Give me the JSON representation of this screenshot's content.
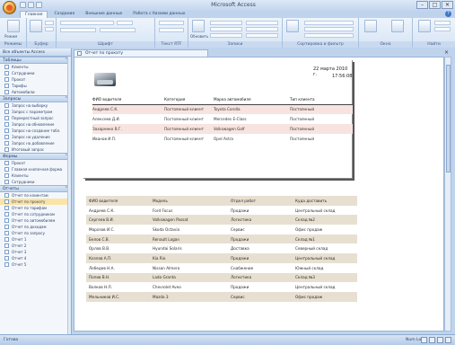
{
  "window": {
    "title": "Microsoft Access",
    "controls": [
      "–",
      "□",
      "✕"
    ]
  },
  "ribbon": {
    "tabs": [
      "Главная",
      "Создание",
      "Внешние данные",
      "Работа с базами данных"
    ],
    "active_tab": 0,
    "groups": [
      "Режимы",
      "Буфер обмена",
      "Шрифт",
      "Текст RTF",
      "Записи",
      "Сортировка и фильтр",
      "Окно",
      "Найти"
    ],
    "big_buttons": [
      "Режим",
      "Вставить",
      "Обновить все",
      "Размер по форме",
      "Перейти",
      "Найти"
    ]
  },
  "nav": {
    "header": "Все объекты Access",
    "sections": [
      {
        "title": "Таблицы",
        "items": [
          "Клиенты",
          "Сотрудники",
          "Прокат",
          "Тарифы",
          "Автомобили"
        ]
      },
      {
        "title": "Запросы",
        "items": [
          "Запрос на выборку",
          "Запрос с параметром",
          "Перекрестный запрос",
          "Запрос на обновление",
          "Запрос на создание табл.",
          "Запрос на удаление",
          "Запрос на добавление",
          "Итоговый запрос"
        ]
      },
      {
        "title": "Формы",
        "items": [
          "Прокат",
          "Главная кнопочная форма",
          "Клиенты",
          "Сотрудники"
        ]
      },
      {
        "title": "Отчеты",
        "items": [
          "Отчет по клиентам",
          "Отчет по прокату",
          "Отчет по тарифам",
          "Отчет по сотрудникам",
          "Отчет по автомобилям",
          "Отчет по доходам",
          "Отчет по запросу",
          "Отчет 1",
          "Отчет 2",
          "Отчет 3",
          "Отчет 4",
          "Отчет 5"
        ]
      }
    ],
    "selected": "Отчет по прокату"
  },
  "document": {
    "tab_title": "Отчет по прокату",
    "page": {
      "date": "22 марта 2010 г.",
      "time": "17:56:08",
      "headers": [
        "ФИО водителя",
        "Категория",
        "Марка автомобиля",
        "Тип клиента"
      ],
      "rows": [
        [
          "Андреев С.К.",
          "Постоянный клиент",
          "Toyota Corolla",
          "Постоянный"
        ],
        [
          "Алексеев Д.И.",
          "Постоянный клиент",
          "Mercedes E-Class",
          "Постоянный"
        ],
        [
          "Захаренко В.Г.",
          "Постоянный клиент",
          "Volkswagen Golf",
          "Постоянный"
        ],
        [
          "Иванов И.П.",
          "Постоянный клиент",
          "Opel Astra",
          "Постоянный"
        ]
      ]
    },
    "list": {
      "headers": [
        "ФИО водителя",
        "Модель",
        "Отдел работ",
        "Куда доставить"
      ],
      "rows": [
        [
          "Андреев С.К.",
          "Ford Focus",
          "Продажи",
          "Центральный склад"
        ],
        [
          "Сергеев В.И.",
          "Volkswagen Passat",
          "Логистика",
          "Склад №2"
        ],
        [
          "Морозов И.С.",
          "Skoda Octavia",
          "Сервис",
          "Офис продаж"
        ],
        [
          "Белов С.В.",
          "Renault Logan",
          "Продажи",
          "Склад №1"
        ],
        [
          "Орлов В.В.",
          "Hyundai Solaris",
          "Доставка",
          "Северный склад"
        ],
        [
          "Козлов А.П.",
          "Kia Rio",
          "Продажи",
          "Центральный склад"
        ],
        [
          "Лебедев Н.А.",
          "Nissan Almera",
          "Снабжение",
          "Южный склад"
        ],
        [
          "Попов В.Н.",
          "Lada Granta",
          "Логистика",
          "Склад №3"
        ],
        [
          "Волков Н.Л.",
          "Chevrolet Aveo",
          "Продажи",
          "Центральный склад"
        ],
        [
          "Мельников И.С.",
          "Mazda 3",
          "Сервис",
          "Офис продаж"
        ]
      ]
    }
  },
  "status": {
    "left": "Готово",
    "right": "Num Lock"
  }
}
